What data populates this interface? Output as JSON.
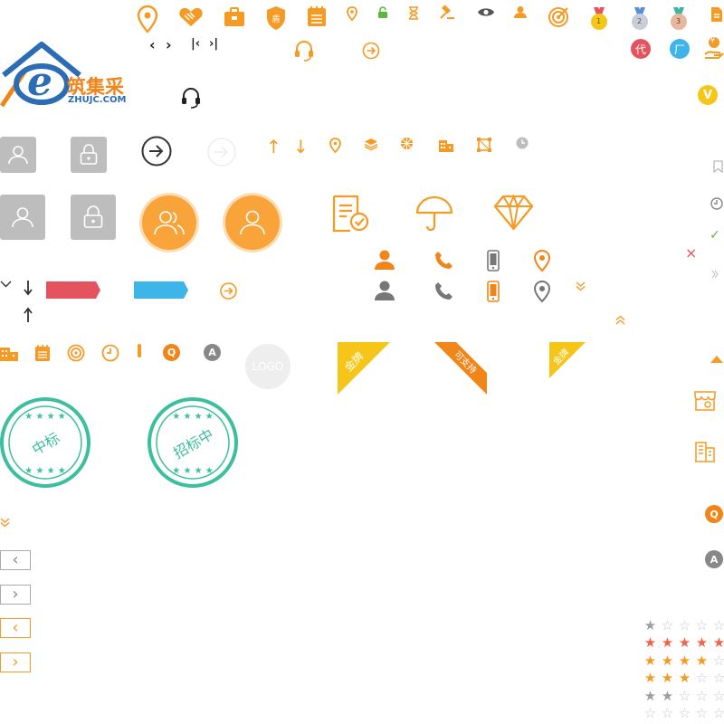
{
  "colors": {
    "orange": "#f59a23",
    "dark_orange": "#f08519",
    "gray": "#8c8c8c",
    "light_gray": "#bdbdbd",
    "teal": "#3cbf9e",
    "green": "#5cb83c",
    "red": "#e5535e",
    "blue": "#3eb5e8",
    "yellow": "#f5c518"
  },
  "logo": {
    "cn_name": "筑集采",
    "domain_text": "ZHUJC.COM",
    "letter": "e"
  },
  "badges": {
    "dai": "代",
    "chang": "厂",
    "v": "V",
    "q": "Q",
    "a": "A",
    "yen": "¥",
    "dun_shield_text": "盾"
  },
  "medals": [
    "1",
    "2",
    "3"
  ],
  "nav_arrows": {
    "prev": "‹",
    "next": "›",
    "first": "|‹",
    "last": "›|"
  },
  "placeholder_logo": "LOGO",
  "ribbons": [
    {
      "text": "金牌",
      "color": "#f5c518"
    },
    {
      "text": "可支持",
      "color": "#f08519"
    },
    {
      "text": "金牌",
      "color": "#f5c518"
    }
  ],
  "stamps": [
    {
      "text": "中标"
    },
    {
      "text": "招标中"
    }
  ],
  "pager": {
    "prev": "‹",
    "next": "›"
  },
  "ratings": [
    {
      "filled": 1,
      "total": 5,
      "color": "#9e9e9e"
    },
    {
      "filled": 5,
      "total": 5,
      "color": "#f06449"
    },
    {
      "filled": 4,
      "total": 5,
      "color": "#f59a23"
    },
    {
      "filled": 3,
      "total": 5,
      "color": "#f59a23"
    },
    {
      "filled": 2,
      "total": 5,
      "color": "#9e9e9e"
    },
    {
      "filled": 0,
      "total": 5,
      "color": "#9e9e9e"
    }
  ],
  "misc": {
    "close_x": "×",
    "check": "✓",
    "arrow_up": "↑",
    "arrow_down": "↓"
  }
}
